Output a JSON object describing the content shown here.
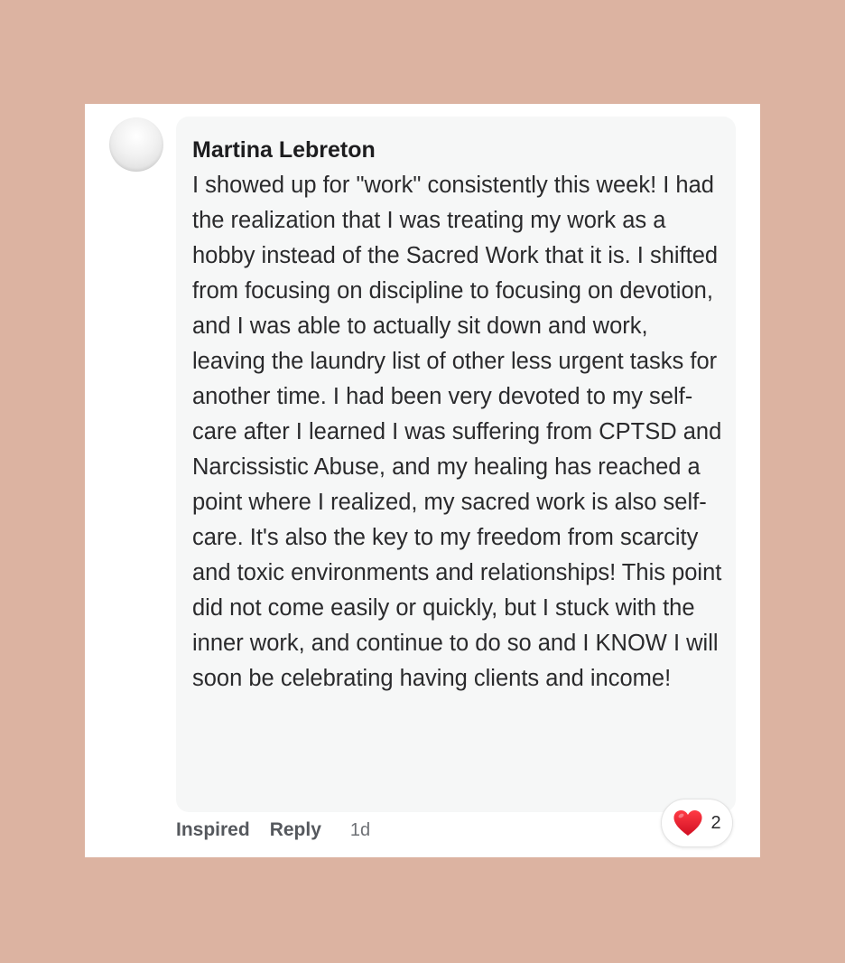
{
  "comment": {
    "author": "Martina Lebreton",
    "text": "I showed up for \"work\" consistently this week! I had the realization that I was treating my work as a hobby instead of the Sacred Work that it is. I shifted from focusing on discipline to focusing on devotion, and I was able to actually sit down and work, leaving the laundry list of other less urgent tasks for another time. I had been very devoted to my self-care after I learned I was suffering from CPTSD and Narcissistic Abuse, and my healing has reached a point where I realized, my sacred work is also self-care. It's also the key to my freedom from scarcity and toxic environments and relationships! This point did not come easily or quickly, but I stuck with the inner work, and continue to do so and I KNOW I will soon be celebrating having clients and income!",
    "actions": {
      "inspired_label": "Inspired",
      "reply_label": "Reply",
      "timestamp": "1d"
    },
    "reaction": {
      "icon": "heart-icon",
      "count": "2",
      "color": "#e0202e"
    }
  },
  "colors": {
    "background": "#dcb3a1",
    "card": "#ffffff",
    "bubble": "#f6f7f7"
  }
}
